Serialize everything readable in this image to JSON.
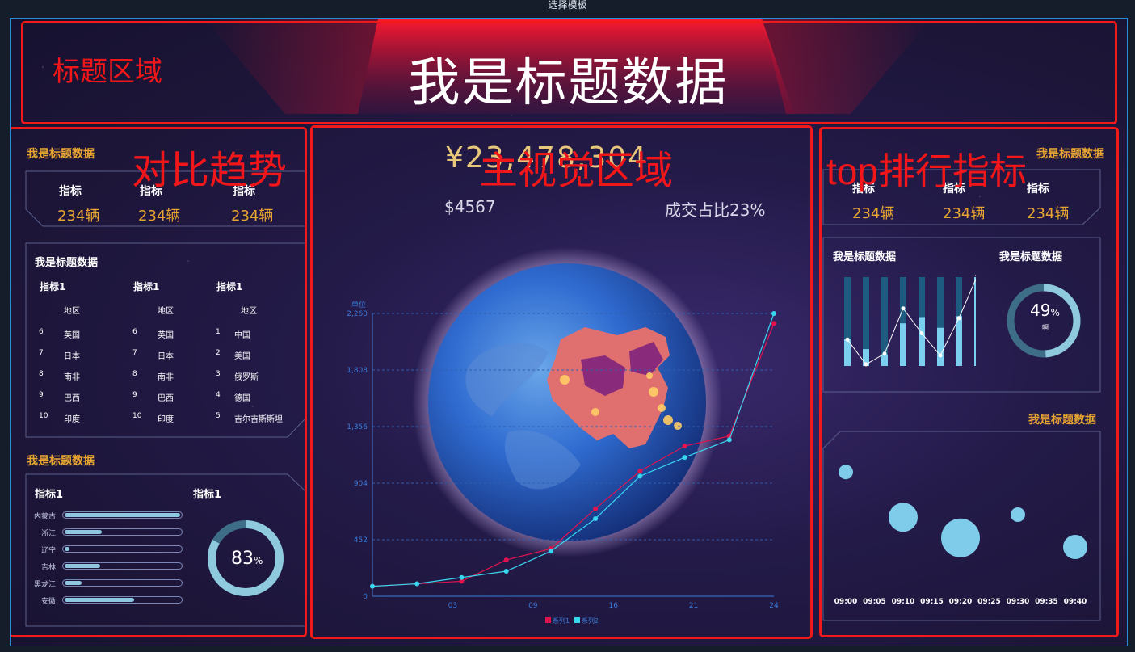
{
  "window": {
    "title": "选择模板"
  },
  "annotations": {
    "title_area": "标题区域",
    "compare_trend": "对比趋势",
    "main_visual": "主视觉区域",
    "top_rank": "top排行指标"
  },
  "header": {
    "title": "我是标题数据"
  },
  "left": {
    "kpi_title": "我是标题数据",
    "kpis": [
      {
        "label": "指标",
        "value": "234辆"
      },
      {
        "label": "指标",
        "value": "234辆"
      },
      {
        "label": "指标",
        "value": "234辆"
      }
    ],
    "table_panel": {
      "title": "我是标题数据",
      "columns": [
        {
          "header": "指标1",
          "subheader": "地区",
          "rows": [
            [
              "6",
              "英国"
            ],
            [
              "7",
              "日本"
            ],
            [
              "8",
              "南非"
            ],
            [
              "9",
              "巴西"
            ],
            [
              "10",
              "印度"
            ]
          ]
        },
        {
          "header": "指标1",
          "subheader": "地区",
          "rows": [
            [
              "6",
              "英国"
            ],
            [
              "7",
              "日本"
            ],
            [
              "8",
              "南非"
            ],
            [
              "9",
              "巴西"
            ],
            [
              "10",
              "印度"
            ]
          ]
        },
        {
          "header": "指标1",
          "subheader": "地区",
          "rows": [
            [
              "1",
              "中国"
            ],
            [
              "2",
              "美国"
            ],
            [
              "3",
              "俄罗斯"
            ],
            [
              "4",
              "德国"
            ],
            [
              "5",
              "吉尔吉斯斯坦"
            ]
          ]
        }
      ]
    },
    "bar_panel_title": "我是标题数据",
    "bar_panel": {
      "left_label": "指标1",
      "right_label": "指标1",
      "bars": [
        {
          "name": "内蒙古",
          "value": 1.0
        },
        {
          "name": "浙江",
          "value": 0.32
        },
        {
          "name": "辽宁",
          "value": 0.04
        },
        {
          "name": "吉林",
          "value": 0.31
        },
        {
          "name": "黑龙江",
          "value": 0.15
        },
        {
          "name": "安徽",
          "value": 0.6
        }
      ],
      "donut": {
        "value": 83,
        "number": "83",
        "unit": "%",
        "color": "#8ec9de",
        "track": "#3e6d87"
      }
    }
  },
  "center": {
    "big_value": "¥23,478,304",
    "stat_left": "$4567",
    "stat_right": "成交占比23%",
    "chart_data": {
      "type": "line",
      "ylabel": "单位",
      "y_ticks": [
        "0",
        "452",
        "904",
        "1,356",
        "1,808",
        "2,260"
      ],
      "x_ticks": [
        "03",
        "09",
        "16",
        "21",
        "24"
      ],
      "ylim": [
        0,
        2260
      ],
      "x": [
        0,
        3,
        6,
        9,
        12,
        15,
        18,
        21,
        24,
        27
      ],
      "series": [
        {
          "name": "系列1",
          "color": "#e0134f",
          "values": [
            80,
            100,
            120,
            290,
            380,
            700,
            1000,
            1200,
            1280,
            2180
          ]
        },
        {
          "name": "系列2",
          "color": "#39d6f0",
          "values": [
            80,
            100,
            150,
            200,
            360,
            620,
            960,
            1110,
            1250,
            2260
          ]
        }
      ]
    }
  },
  "right": {
    "kpi_title": "我是标题数据",
    "kpis": [
      {
        "label": "指标",
        "value": "234辆"
      },
      {
        "label": "指标",
        "value": "234辆"
      },
      {
        "label": "指标",
        "value": "234辆"
      }
    ],
    "mid_panel": {
      "left_title": "我是标题数据",
      "right_title": "我是标题数据",
      "bars": [
        0.3,
        0.19,
        0.13,
        0.48,
        0.55,
        0.43,
        0.56,
        1.0
      ],
      "line": [
        0.28,
        0.0,
        0.12,
        0.63,
        0.35,
        0.1,
        0.52,
        1.0
      ],
      "donut": {
        "value": 49,
        "number": "49",
        "unit": "%",
        "sub": "啊",
        "color": "#8ec9de",
        "track": "#3e6d87"
      }
    },
    "bubble_title": "我是标题数据",
    "bubbles": {
      "times": [
        "09:00",
        "09:05",
        "09:10",
        "09:15",
        "09:20",
        "09:25",
        "09:30",
        "09:35",
        "09:40"
      ],
      "points": [
        {
          "x": "09:00",
          "level": 0.93,
          "size": 18
        },
        {
          "x": "09:10",
          "level": 0.58,
          "size": 36
        },
        {
          "x": "09:20",
          "level": 0.42,
          "size": 48
        },
        {
          "x": "09:30",
          "level": 0.6,
          "size": 18
        },
        {
          "x": "09:40",
          "level": 0.35,
          "size": 30
        }
      ]
    }
  }
}
